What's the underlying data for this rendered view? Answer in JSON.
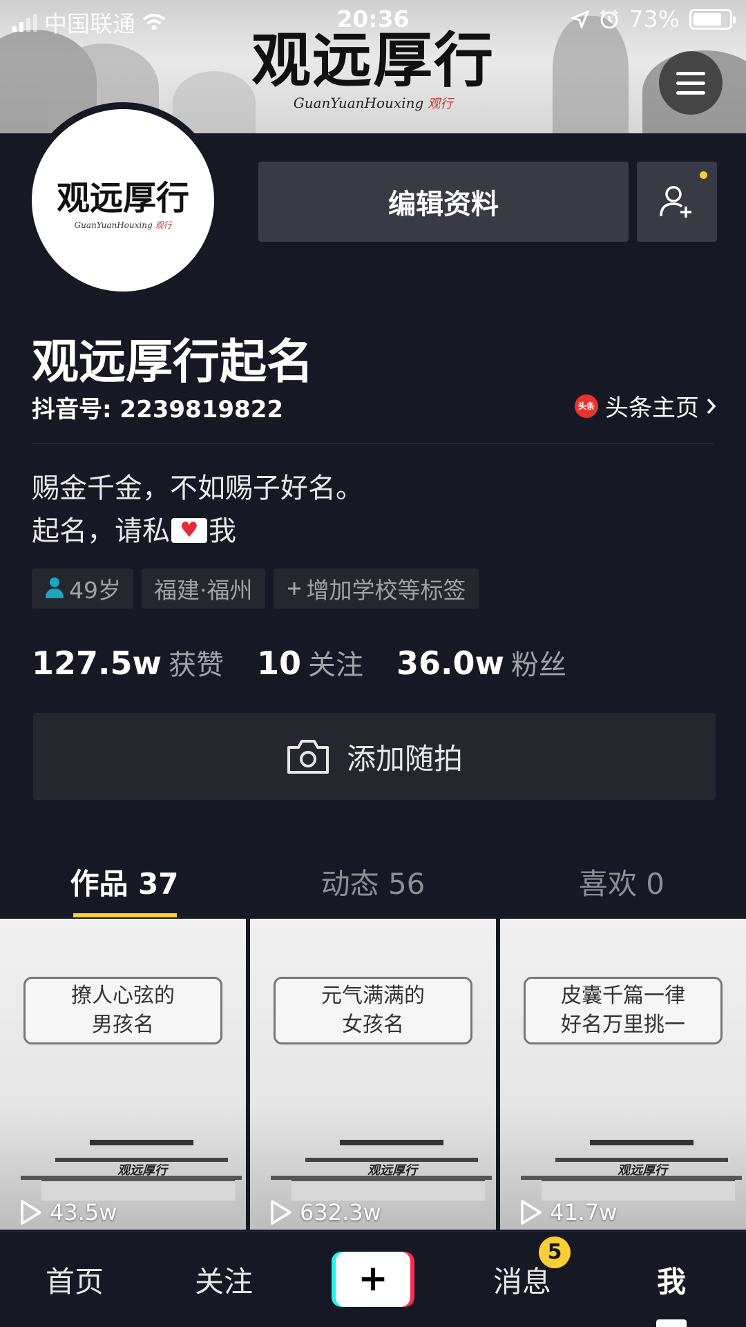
{
  "status_bar": {
    "carrier": "中国联通",
    "time": "20:36",
    "battery": "73%"
  },
  "banner": {
    "logo_text": "观远厚行",
    "logo_subtitle": "GuanYuanHouxing",
    "logo_seal": "观行"
  },
  "avatar": {
    "logo_text": "观远厚行",
    "logo_subtitle": "GuanYuanHouxing",
    "logo_seal": "观行"
  },
  "profile": {
    "edit_label": "编辑资料",
    "nickname": "观远厚行起名",
    "douyin_id": "抖音号: 2239819822",
    "toutiao_badge": "头条",
    "toutiao_label": "头条主页"
  },
  "bio": {
    "line1": "赐金千金，不如赐子好名。",
    "line2_pre": "起名，请私",
    "line2_post": "我"
  },
  "tags": {
    "age": "49岁",
    "location": "福建·福州",
    "add": "增加学校等标签"
  },
  "stats": {
    "likes_num": "127.5w",
    "likes_label": "获赞",
    "following_num": "10",
    "following_label": "关注",
    "fans_num": "36.0w",
    "fans_label": "粉丝"
  },
  "snap": {
    "label": "添加随拍"
  },
  "tabs": [
    {
      "label": "作品 37"
    },
    {
      "label": "动态 56"
    },
    {
      "label": "喜欢 0"
    }
  ],
  "videos": [
    {
      "line1": "撩人心弦的",
      "line2": "男孩名",
      "seal": "观远厚行",
      "plays": "43.5w"
    },
    {
      "line1": "元气满满的",
      "line2": "女孩名",
      "seal": "观远厚行",
      "plays": "632.3w"
    },
    {
      "line1": "皮囊千篇一律",
      "line2": "好名万里挑一",
      "seal": "观远厚行",
      "plays": "41.7w"
    }
  ],
  "bottom_nav": {
    "home": "首页",
    "follow": "关注",
    "plus": "+",
    "messages": "消息",
    "messages_badge": "5",
    "me": "我"
  },
  "colors": {
    "background": "#161823",
    "button": "#393b44",
    "accent": "#facf34"
  }
}
